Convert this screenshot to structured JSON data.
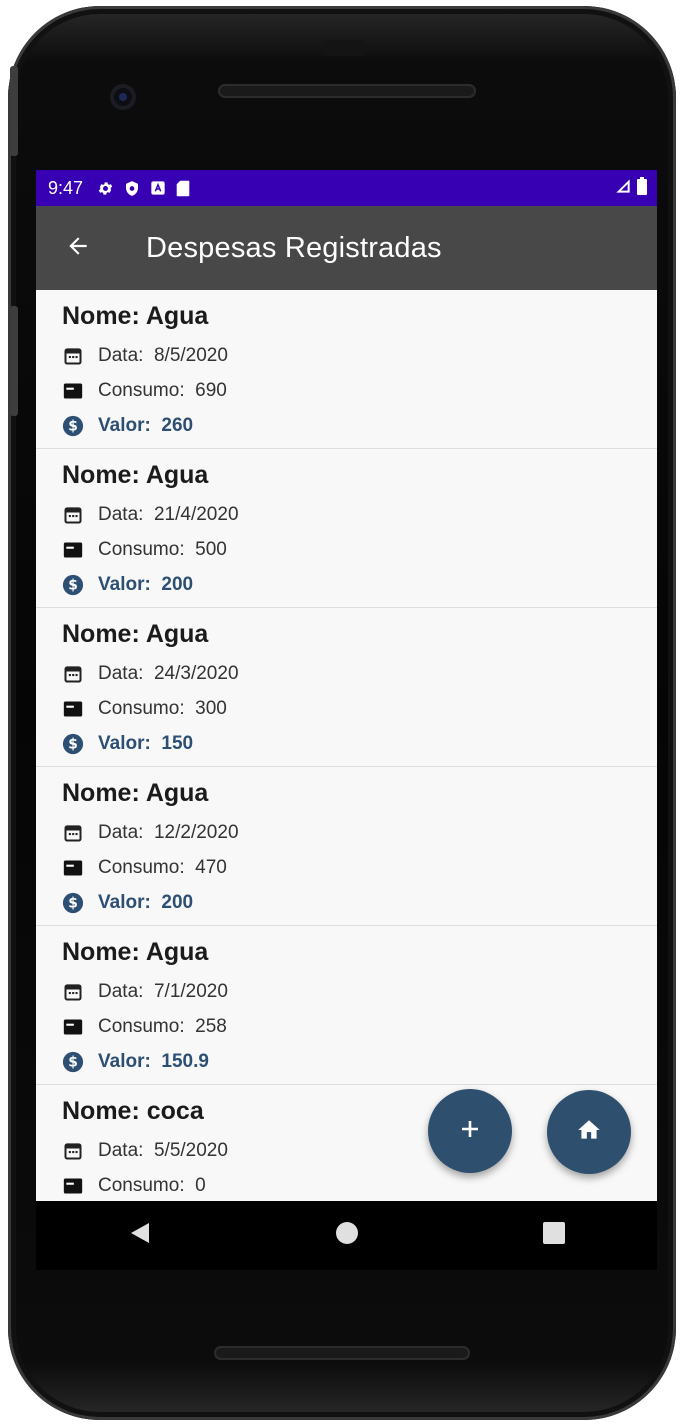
{
  "status_bar": {
    "time": "9:47",
    "icons": [
      "settings-icon",
      "shield-icon",
      "font-a-icon",
      "sd-card-icon"
    ],
    "right_icons": [
      "signal-icon",
      "battery-icon"
    ],
    "color": "#3700b3"
  },
  "app_bar": {
    "title": "Despesas Registradas",
    "back_icon": "arrow-back-icon",
    "color": "#484848"
  },
  "expenses": [
    {
      "name_label": "Nome:",
      "name": "Agua",
      "date_label": "Data:",
      "date": "8/5/2020",
      "consumo_label": "Consumo:",
      "consumo": "690",
      "valor_label": "Valor:",
      "valor": "260"
    },
    {
      "name_label": "Nome:",
      "name": "Agua",
      "date_label": "Data:",
      "date": "21/4/2020",
      "consumo_label": "Consumo:",
      "consumo": "500",
      "valor_label": "Valor:",
      "valor": "200"
    },
    {
      "name_label": "Nome:",
      "name": "Agua",
      "date_label": "Data:",
      "date": "24/3/2020",
      "consumo_label": "Consumo:",
      "consumo": "300",
      "valor_label": "Valor:",
      "valor": "150"
    },
    {
      "name_label": "Nome:",
      "name": "Agua",
      "date_label": "Data:",
      "date": "12/2/2020",
      "consumo_label": "Consumo:",
      "consumo": "470",
      "valor_label": "Valor:",
      "valor": "200"
    },
    {
      "name_label": "Nome:",
      "name": "Agua",
      "date_label": "Data:",
      "date": "7/1/2020",
      "consumo_label": "Consumo:",
      "consumo": "258",
      "valor_label": "Valor:",
      "valor": "150.9"
    },
    {
      "name_label": "Nome:",
      "name": "coca",
      "date_label": "Data:",
      "date": "5/5/2020",
      "consumo_label": "Consumo:",
      "consumo": "0"
    }
  ],
  "fabs": {
    "add_icon": "plus-icon",
    "home_icon": "home-icon",
    "color": "#2f4f6f"
  },
  "nav": [
    "back-triangle-icon",
    "home-circle-icon",
    "recents-square-icon"
  ],
  "accent_value_color": "#2d4f73"
}
